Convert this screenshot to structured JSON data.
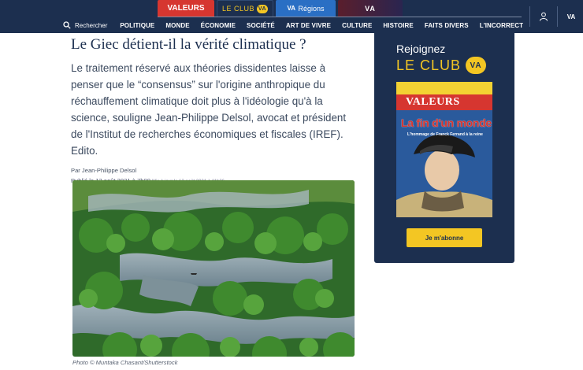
{
  "brand_tabs": {
    "valeurs": "VALEURS",
    "club": "LE CLUB",
    "club_badge": "VA",
    "regions": "Régions",
    "regions_badge": "VA",
    "vatv": "VA"
  },
  "nav": {
    "search_label": "Rechercher",
    "items": [
      "POLITIQUE",
      "MONDE",
      "ÉCONOMIE",
      "SOCIÉTÉ",
      "ART DE VIVRE",
      "CULTURE",
      "HISTOIRE",
      "FAITS DIVERS",
      "L'INCORRECT"
    ]
  },
  "header_right": {
    "va_label": "VA"
  },
  "article": {
    "title": "Le Giec détient-il la vérité climatique ?",
    "lead": "Le traitement réservé aux théories dissidentes laisse à penser que le “consensus” sur l'origine anthropique du réchauffement climatique doit plus à l'idéologie qu'à la science, souligne Jean-Philippe Delsol, avocat et président de l'Institut de recherches économiques et fiscales (IREF). Edito.",
    "byline": "Par Jean-Philippe Delsol",
    "published": "Publié le 13 août 2021 à 7h00",
    "updated": "Mis à jour le 12 août 2021 à 11h36",
    "caption": "Photo © Muntaka Chasant/Shutterstock"
  },
  "promo": {
    "join": "Rejoignez",
    "club": "LE CLUB",
    "club_badge": "VA",
    "magazine": {
      "masthead": "VALEURS",
      "headline": "La fin d'un monde",
      "subheadline": "L'hommage de Franck Ferrand à la reine"
    },
    "cta": "Je m'abonne"
  },
  "colors": {
    "header_bg": "#1c2f4f",
    "accent_yellow": "#f3c623",
    "accent_red": "#d63630",
    "regions_blue": "#2a6fc4"
  }
}
